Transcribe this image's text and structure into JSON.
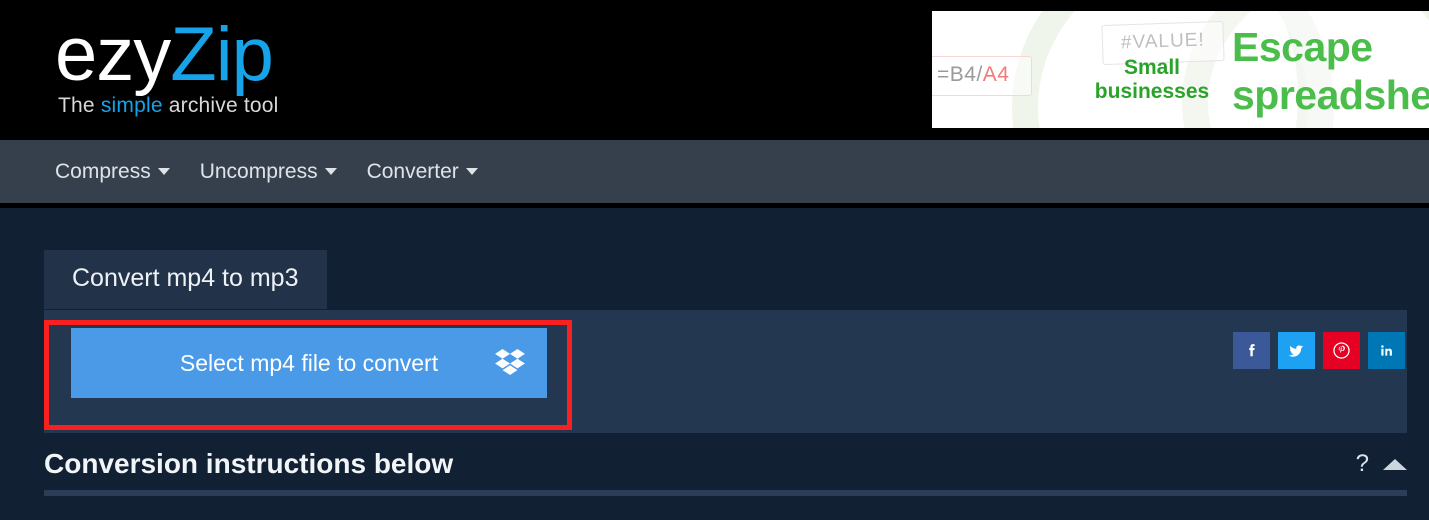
{
  "header": {
    "logo": {
      "part1": "ezy",
      "part2": "Zip",
      "tagline_before": "The ",
      "tagline_highlight": "simple",
      "tagline_after": " archive tool"
    },
    "ad": {
      "formula_text": "=B4/",
      "formula_error": "A4",
      "value_error": "#VALUE!",
      "small_line1": "Small",
      "small_line2": "businesses",
      "headline_line1": "Escape",
      "headline_line2": "spreadshe"
    }
  },
  "nav": {
    "items": [
      {
        "label": "Compress",
        "icon": "chevron-down-icon"
      },
      {
        "label": "Uncompress",
        "icon": "chevron-down-icon"
      },
      {
        "label": "Converter",
        "icon": "chevron-down-icon"
      }
    ]
  },
  "main": {
    "tab": {
      "label": "Convert mp4 to mp3"
    },
    "upload_button": {
      "label": "Select mp4 file to convert",
      "icon": "dropbox-icon"
    },
    "social": [
      {
        "name": "facebook",
        "glyph": "f",
        "color": "#3b5998"
      },
      {
        "name": "twitter",
        "glyph": "bird",
        "color": "#1da1f2"
      },
      {
        "name": "pinterest",
        "glyph": "p",
        "color": "#e60023"
      },
      {
        "name": "linkedin",
        "glyph": "in",
        "color": "#0077b5"
      }
    ],
    "instructions": {
      "title": "Conversion instructions below",
      "help_label": "?",
      "collapse_icon": "caret-up-icon"
    }
  },
  "colors": {
    "page_background": "#122033",
    "panel_background": "#243751",
    "tab_background": "#223349",
    "navbar_background": "#36404c",
    "header_background": "#000000",
    "accent_blue": "#4a9ae8",
    "logo_blue": "#17a3e8",
    "highlight_red": "#fa2020",
    "ad_green": "#4bbd4b"
  }
}
